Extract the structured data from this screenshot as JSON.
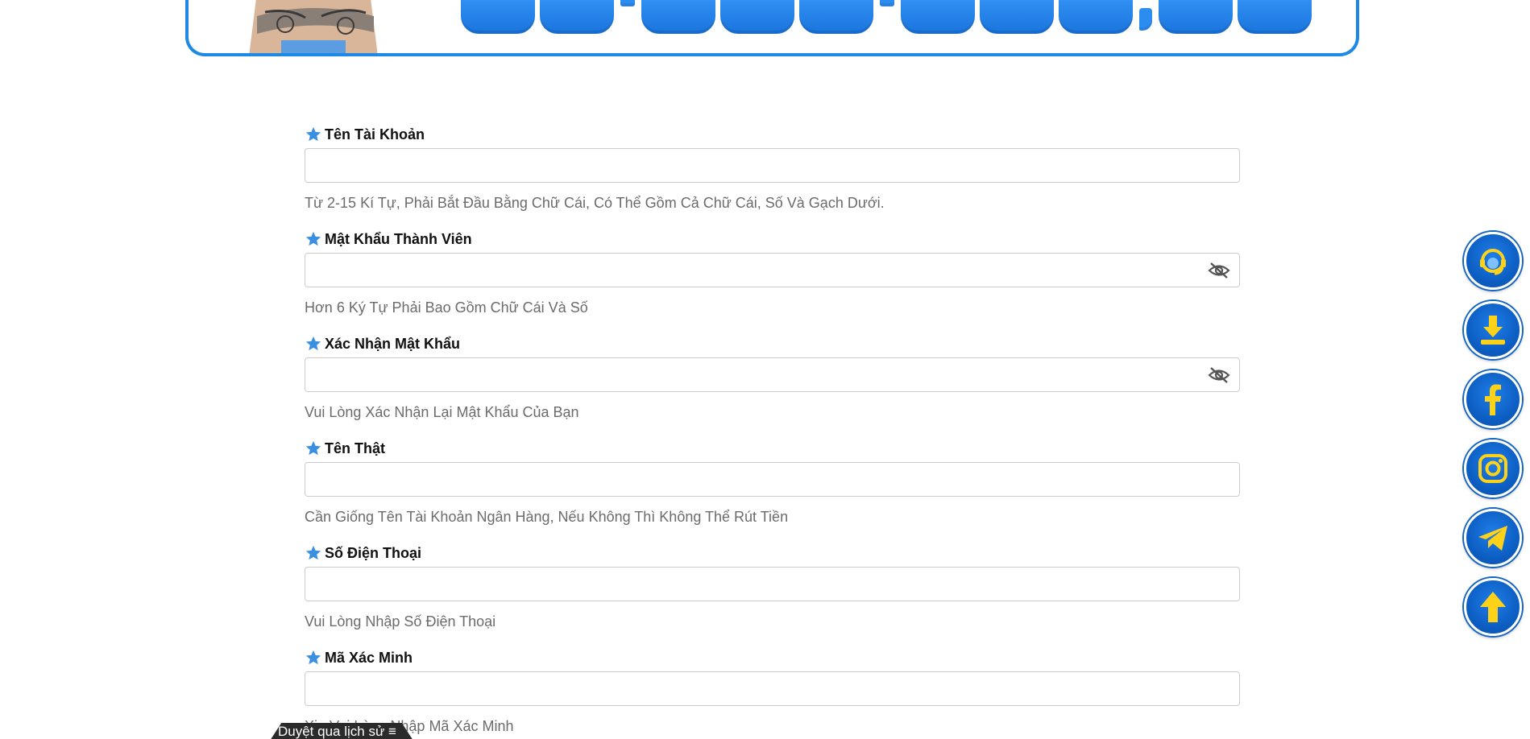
{
  "banner": {
    "figure": "person-arms-crossed-tattoo",
    "digits_color": "#2d8cf0"
  },
  "form": {
    "fields": [
      {
        "label": "Tên Tài Khoản",
        "value": "",
        "hint": "Từ 2-15 Kí Tự, Phải Bắt Đầu Bằng Chữ Cái, Có Thể Gồm Cả Chữ Cái, Số Và Gạch Dưới."
      },
      {
        "label": "Mật Khẩu Thành Viên",
        "value": "",
        "hint": "Hơn 6 Ký Tự Phải Bao Gồm Chữ Cái Và Số",
        "icon": "eye-slash-icon"
      },
      {
        "label": "Xác Nhận Mật Khẩu",
        "value": "",
        "hint": "Vui Lòng Xác Nhận Lại Mật Khẩu Của Bạn",
        "icon": "eye-slash-icon"
      },
      {
        "label": "Tên Thật",
        "value": "",
        "hint": "Cần Giống Tên Tài Khoản Ngân Hàng, Nếu Không Thì Không Thể Rút Tiền"
      },
      {
        "label": "Số Điện Thoại",
        "value": "",
        "hint": "Vui Lòng Nhập Số Điện Thoại"
      },
      {
        "label": "Mã Xác Minh",
        "value": "",
        "hint": "Xin Vui Lòng Nhập Mã Xác Minh"
      }
    ],
    "required_icon_color": "#3b8fe0"
  },
  "side_buttons": [
    {
      "name": "customer-support-button",
      "icon": "headset-support-icon"
    },
    {
      "name": "download-button",
      "icon": "download-icon"
    },
    {
      "name": "facebook-button",
      "icon": "facebook-icon"
    },
    {
      "name": "instagram-button",
      "icon": "instagram-icon"
    },
    {
      "name": "telegram-button",
      "icon": "telegram-icon"
    },
    {
      "name": "scroll-top-button",
      "icon": "arrow-up-icon"
    }
  ],
  "history_tab": {
    "label": "Duyệt qua lịch sử ≡"
  },
  "colors": {
    "accent": "#1e88e5",
    "icon_yellow": "#ffd21a",
    "hint": "#6b6b6b"
  }
}
